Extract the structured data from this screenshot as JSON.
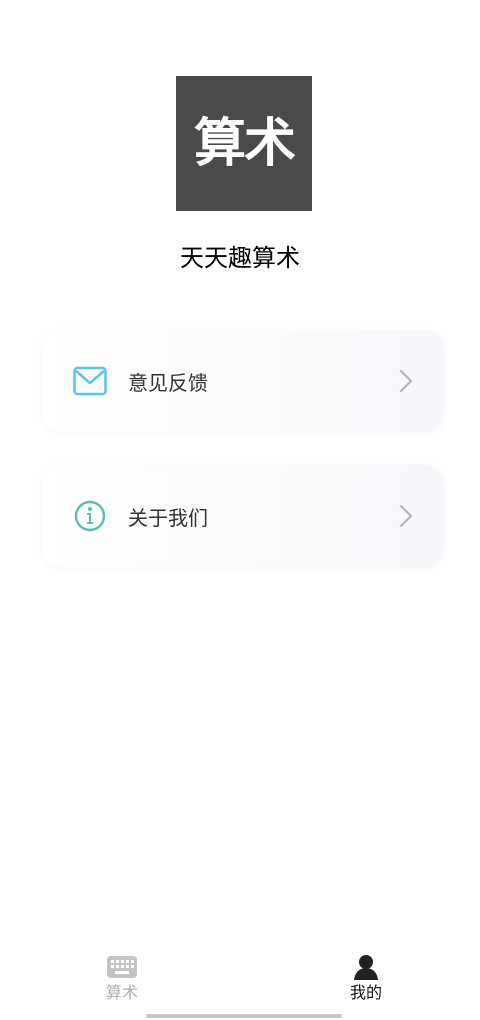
{
  "app": {
    "logo_text": "算术",
    "name": "天天趣算术"
  },
  "menu": {
    "items": [
      {
        "label": "意见反馈",
        "icon": "mail-icon",
        "icon_color": "#5bc4e6"
      },
      {
        "label": "关于我们",
        "icon": "info-icon",
        "icon_color": "#5cbfae"
      }
    ]
  },
  "tabbar": {
    "tabs": [
      {
        "label": "算术",
        "icon": "keyboard-icon",
        "active": false
      },
      {
        "label": "我的",
        "icon": "person-icon",
        "active": true
      }
    ]
  },
  "colors": {
    "logo_bg": "#4a4a4a",
    "tab_active": "#111111",
    "tab_inactive": "#b0b0b0"
  }
}
